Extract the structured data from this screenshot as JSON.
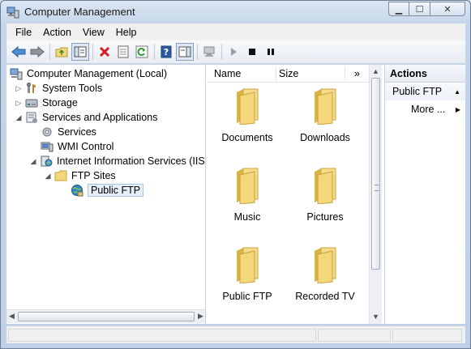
{
  "window": {
    "title": "Computer Management",
    "app_icon": "computer-management-icon"
  },
  "caption_buttons": {
    "minimize": "minimize-icon",
    "maximize": "maximize-icon",
    "close": "close-icon"
  },
  "menu": [
    "File",
    "Action",
    "View",
    "Help"
  ],
  "toolbar": {
    "buttons": [
      "back-arrow-icon",
      "forward-arrow-icon",
      "up-folder-icon",
      "show-hide-tree-icon",
      "delete-icon",
      "properties-icon",
      "refresh-icon",
      "help-icon",
      "show-hide-action-pane-icon",
      "connect-computer-icon",
      "start-icon",
      "stop-icon",
      "pause-icon"
    ]
  },
  "tree": {
    "items": [
      {
        "label": "Computer Management (Local)",
        "icon": "computer-management-icon"
      },
      {
        "label": "System Tools",
        "icon": "system-tools-icon",
        "expander": "▷"
      },
      {
        "label": "Storage",
        "icon": "storage-icon",
        "expander": "▷"
      },
      {
        "label": "Services and Applications",
        "icon": "services-applications-icon",
        "expander": "◢"
      },
      {
        "label": "Services",
        "icon": "services-icon"
      },
      {
        "label": "WMI Control",
        "icon": "wmi-control-icon"
      },
      {
        "label": "Internet Information Services (IIS) (",
        "icon": "iis-icon",
        "expander": "◢"
      },
      {
        "label": "FTP Sites",
        "icon": "folder-icon",
        "expander": "◢"
      },
      {
        "label": "Public FTP",
        "icon": "ftp-site-icon"
      }
    ]
  },
  "list": {
    "columns": [
      "Name",
      "Size"
    ],
    "more_columns": "»",
    "items": [
      "Documents",
      "Downloads",
      "Music",
      "Pictures",
      "Public FTP",
      "Recorded TV"
    ]
  },
  "actions": {
    "header": "Actions",
    "section": "Public FTP",
    "items": [
      "More ..."
    ]
  },
  "colors": {
    "folder": "#f3d77a",
    "folder_dark": "#d9b445",
    "selection": "#e6eef8"
  }
}
